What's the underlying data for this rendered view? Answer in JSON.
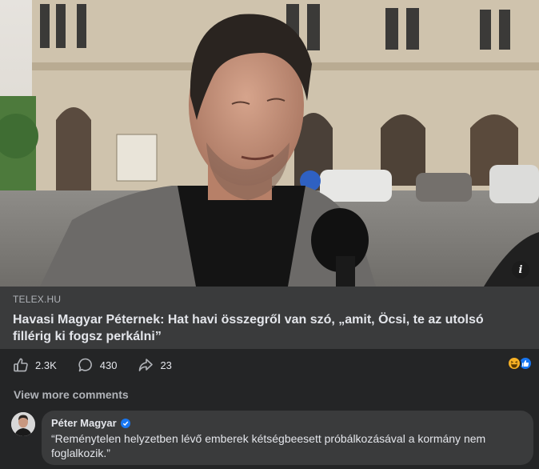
{
  "post": {
    "image_alt": "Portrait of a man in a dark jacket speaking into a microphone on a city street",
    "info_glyph": "i",
    "link": {
      "source": "TELEX.HU",
      "title": "Havasi Magyar Péternek: Hat havi összegről van szó, „amit, Öcsi, te az utolsó fillérig ki fogsz perkálni”"
    },
    "actions": {
      "likes": "2.3K",
      "comments": "430",
      "shares": "23"
    },
    "reactions": [
      "haha-icon",
      "like-icon"
    ]
  },
  "comments": {
    "view_more_label": "View more comments",
    "items": [
      {
        "author": "Péter Magyar",
        "verified": true,
        "text": "“Reménytelen helyzetben lévő emberek kétségbeesett próbálkozásával a kormány nem foglalkozik.”"
      }
    ]
  },
  "colors": {
    "background": "#242526",
    "card": "#3a3b3c",
    "text_primary": "#e4e6eb",
    "text_secondary": "#b0b3b8",
    "accent": "#1877f2"
  }
}
